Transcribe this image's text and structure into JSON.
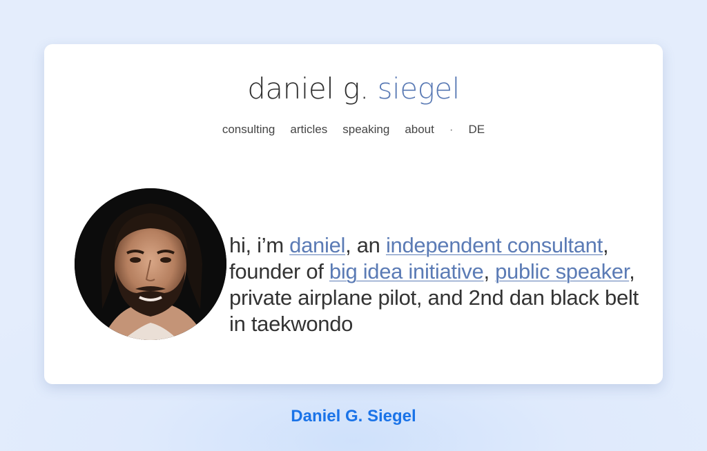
{
  "header": {
    "name_first": "daniel g.",
    "name_last": "siegel"
  },
  "nav": {
    "items": [
      "consulting",
      "articles",
      "speaking",
      "about"
    ],
    "separator": "·",
    "language": "DE"
  },
  "intro": {
    "p1": "hi, i’m ",
    "link_daniel": "daniel",
    "p2": ", an ",
    "link_consultant": "independent consultant",
    "p3": ", founder of ",
    "link_big_idea": "big idea initiative",
    "p4": ", ",
    "link_speaker": "public speaker",
    "p5": ", private airplane pilot, and 2nd dan black belt in taekwondo"
  },
  "caption": "Daniel G. Siegel",
  "colors": {
    "accent": "#5b7bb5",
    "caption": "#1a73e8",
    "background": "#e4edfc"
  }
}
